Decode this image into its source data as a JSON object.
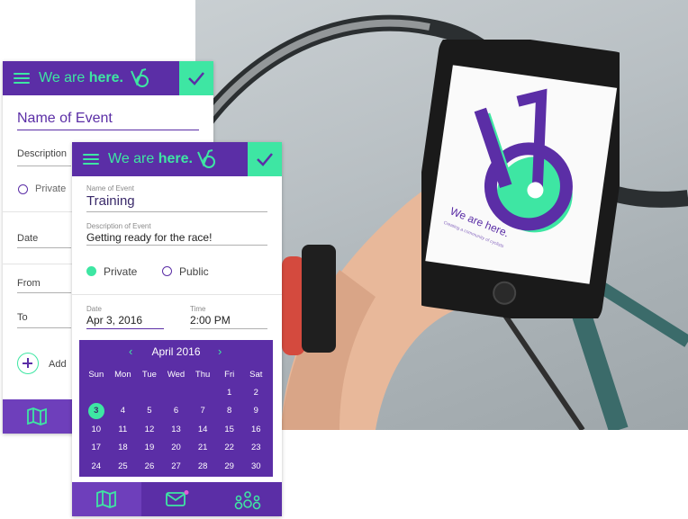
{
  "brand": {
    "prefix": "We are ",
    "bold": "here."
  },
  "back_card": {
    "title": "Name of Event",
    "description": "Description",
    "private": "Private",
    "date": "Date",
    "from": "From",
    "to": "To",
    "add": "Add"
  },
  "front_card": {
    "name_label": "Name of Event",
    "name_value": "Training",
    "desc_label": "Description of Event",
    "desc_value": "Getting ready for the race!",
    "private": "Private",
    "public": "Public",
    "date_label": "Date",
    "date_value": "Apr 3, 2016",
    "time_label": "Time",
    "time_value": "2:00 PM"
  },
  "calendar": {
    "month": "April 2016",
    "weekdays": [
      "Sun",
      "Mon",
      "Tue",
      "Wed",
      "Thu",
      "Fri",
      "Sat"
    ],
    "weeks": [
      [
        "",
        "",
        "",
        "",
        "",
        "1",
        "2"
      ],
      [
        "3",
        "4",
        "5",
        "6",
        "7",
        "8",
        "9"
      ],
      [
        "10",
        "11",
        "12",
        "13",
        "14",
        "15",
        "16"
      ],
      [
        "17",
        "18",
        "19",
        "20",
        "21",
        "22",
        "23"
      ],
      [
        "24",
        "25",
        "26",
        "27",
        "28",
        "29",
        "30"
      ]
    ],
    "selected": "3"
  },
  "phone_screen": {
    "tagline": "We are here.",
    "subline": "Creating a community of cyclists"
  },
  "colors": {
    "purple": "#5b2ea6",
    "green": "#3ee6a3"
  }
}
